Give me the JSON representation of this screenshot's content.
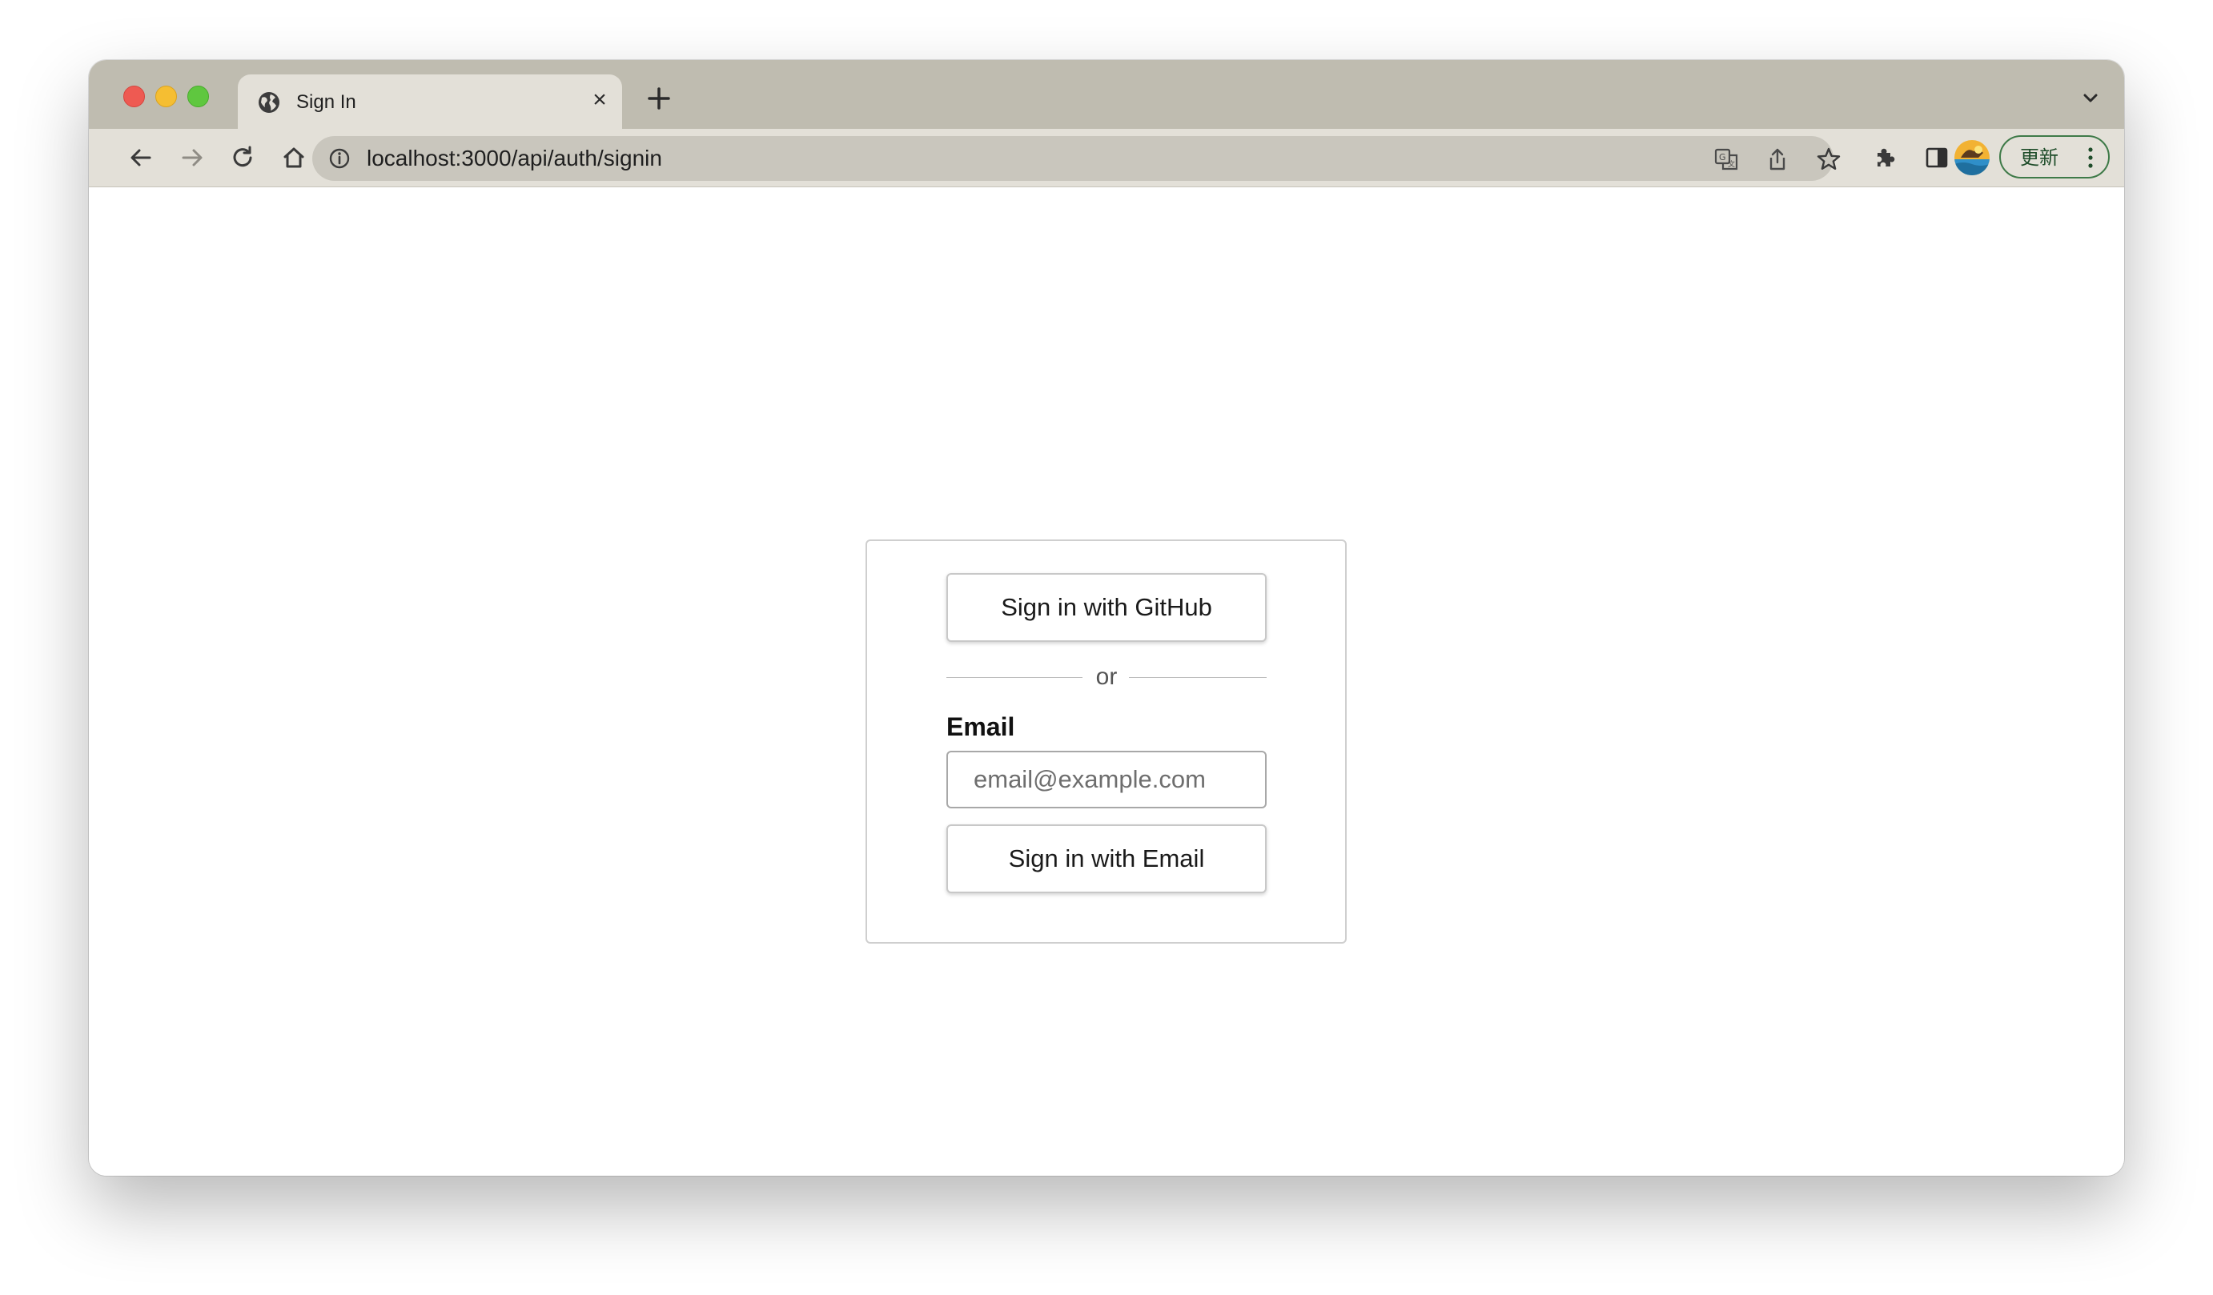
{
  "browser": {
    "tab": {
      "title": "Sign In",
      "close_icon": "close-icon",
      "favicon": "globe-icon"
    },
    "new_tab_icon": "plus-icon",
    "tab_list_icon": "chevron-down-icon",
    "toolbar": {
      "back_icon": "arrow-left-icon",
      "forward_icon": "arrow-right-icon",
      "reload_icon": "reload-icon",
      "home_icon": "home-icon",
      "site_info_icon": "info-icon",
      "url": "localhost:3000/api/auth/signin",
      "translate_icon": "translate-icon",
      "share_icon": "share-icon",
      "bookmark_icon": "star-icon",
      "extensions_icon": "puzzle-icon",
      "side_panel_icon": "side-panel-icon",
      "update_label": "更新",
      "menu_icon": "kebab-menu-icon"
    },
    "colors": {
      "titlebar": "#bfbcb0",
      "toolbar": "#e3e0d8",
      "update_border": "#3e7a48"
    }
  },
  "signin": {
    "github_button": "Sign in with GitHub",
    "divider_text": "or",
    "email_label": "Email",
    "email_placeholder": "email@example.com",
    "email_value": "",
    "email_button": "Sign in with Email"
  }
}
